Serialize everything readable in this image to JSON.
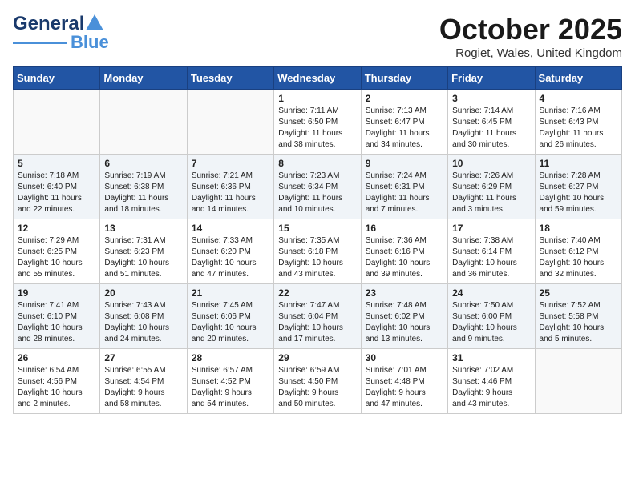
{
  "header": {
    "logo_line1": "General",
    "logo_line2": "Blue",
    "month": "October 2025",
    "location": "Rogiet, Wales, United Kingdom"
  },
  "weekdays": [
    "Sunday",
    "Monday",
    "Tuesday",
    "Wednesday",
    "Thursday",
    "Friday",
    "Saturday"
  ],
  "weeks": [
    [
      {
        "day": "",
        "content": ""
      },
      {
        "day": "",
        "content": ""
      },
      {
        "day": "",
        "content": ""
      },
      {
        "day": "1",
        "content": "Sunrise: 7:11 AM\nSunset: 6:50 PM\nDaylight: 11 hours\nand 38 minutes."
      },
      {
        "day": "2",
        "content": "Sunrise: 7:13 AM\nSunset: 6:47 PM\nDaylight: 11 hours\nand 34 minutes."
      },
      {
        "day": "3",
        "content": "Sunrise: 7:14 AM\nSunset: 6:45 PM\nDaylight: 11 hours\nand 30 minutes."
      },
      {
        "day": "4",
        "content": "Sunrise: 7:16 AM\nSunset: 6:43 PM\nDaylight: 11 hours\nand 26 minutes."
      }
    ],
    [
      {
        "day": "5",
        "content": "Sunrise: 7:18 AM\nSunset: 6:40 PM\nDaylight: 11 hours\nand 22 minutes."
      },
      {
        "day": "6",
        "content": "Sunrise: 7:19 AM\nSunset: 6:38 PM\nDaylight: 11 hours\nand 18 minutes."
      },
      {
        "day": "7",
        "content": "Sunrise: 7:21 AM\nSunset: 6:36 PM\nDaylight: 11 hours\nand 14 minutes."
      },
      {
        "day": "8",
        "content": "Sunrise: 7:23 AM\nSunset: 6:34 PM\nDaylight: 11 hours\nand 10 minutes."
      },
      {
        "day": "9",
        "content": "Sunrise: 7:24 AM\nSunset: 6:31 PM\nDaylight: 11 hours\nand 7 minutes."
      },
      {
        "day": "10",
        "content": "Sunrise: 7:26 AM\nSunset: 6:29 PM\nDaylight: 11 hours\nand 3 minutes."
      },
      {
        "day": "11",
        "content": "Sunrise: 7:28 AM\nSunset: 6:27 PM\nDaylight: 10 hours\nand 59 minutes."
      }
    ],
    [
      {
        "day": "12",
        "content": "Sunrise: 7:29 AM\nSunset: 6:25 PM\nDaylight: 10 hours\nand 55 minutes."
      },
      {
        "day": "13",
        "content": "Sunrise: 7:31 AM\nSunset: 6:23 PM\nDaylight: 10 hours\nand 51 minutes."
      },
      {
        "day": "14",
        "content": "Sunrise: 7:33 AM\nSunset: 6:20 PM\nDaylight: 10 hours\nand 47 minutes."
      },
      {
        "day": "15",
        "content": "Sunrise: 7:35 AM\nSunset: 6:18 PM\nDaylight: 10 hours\nand 43 minutes."
      },
      {
        "day": "16",
        "content": "Sunrise: 7:36 AM\nSunset: 6:16 PM\nDaylight: 10 hours\nand 39 minutes."
      },
      {
        "day": "17",
        "content": "Sunrise: 7:38 AM\nSunset: 6:14 PM\nDaylight: 10 hours\nand 36 minutes."
      },
      {
        "day": "18",
        "content": "Sunrise: 7:40 AM\nSunset: 6:12 PM\nDaylight: 10 hours\nand 32 minutes."
      }
    ],
    [
      {
        "day": "19",
        "content": "Sunrise: 7:41 AM\nSunset: 6:10 PM\nDaylight: 10 hours\nand 28 minutes."
      },
      {
        "day": "20",
        "content": "Sunrise: 7:43 AM\nSunset: 6:08 PM\nDaylight: 10 hours\nand 24 minutes."
      },
      {
        "day": "21",
        "content": "Sunrise: 7:45 AM\nSunset: 6:06 PM\nDaylight: 10 hours\nand 20 minutes."
      },
      {
        "day": "22",
        "content": "Sunrise: 7:47 AM\nSunset: 6:04 PM\nDaylight: 10 hours\nand 17 minutes."
      },
      {
        "day": "23",
        "content": "Sunrise: 7:48 AM\nSunset: 6:02 PM\nDaylight: 10 hours\nand 13 minutes."
      },
      {
        "day": "24",
        "content": "Sunrise: 7:50 AM\nSunset: 6:00 PM\nDaylight: 10 hours\nand 9 minutes."
      },
      {
        "day": "25",
        "content": "Sunrise: 7:52 AM\nSunset: 5:58 PM\nDaylight: 10 hours\nand 5 minutes."
      }
    ],
    [
      {
        "day": "26",
        "content": "Sunrise: 6:54 AM\nSunset: 4:56 PM\nDaylight: 10 hours\nand 2 minutes."
      },
      {
        "day": "27",
        "content": "Sunrise: 6:55 AM\nSunset: 4:54 PM\nDaylight: 9 hours\nand 58 minutes."
      },
      {
        "day": "28",
        "content": "Sunrise: 6:57 AM\nSunset: 4:52 PM\nDaylight: 9 hours\nand 54 minutes."
      },
      {
        "day": "29",
        "content": "Sunrise: 6:59 AM\nSunset: 4:50 PM\nDaylight: 9 hours\nand 50 minutes."
      },
      {
        "day": "30",
        "content": "Sunrise: 7:01 AM\nSunset: 4:48 PM\nDaylight: 9 hours\nand 47 minutes."
      },
      {
        "day": "31",
        "content": "Sunrise: 7:02 AM\nSunset: 4:46 PM\nDaylight: 9 hours\nand 43 minutes."
      },
      {
        "day": "",
        "content": ""
      }
    ]
  ]
}
